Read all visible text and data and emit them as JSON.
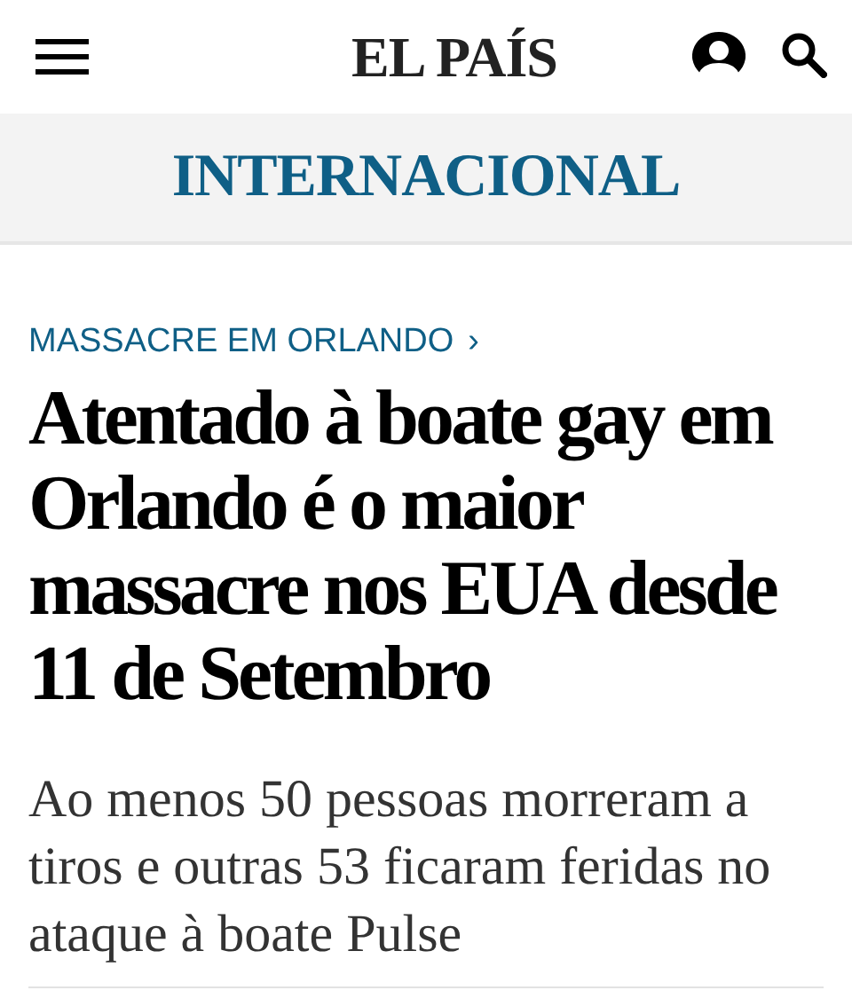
{
  "header": {
    "logo": "EL PAÍS"
  },
  "section": {
    "title": "INTERNACIONAL"
  },
  "article": {
    "kicker": "MASSACRE EM ORLANDO",
    "kicker_arrow": "›",
    "headline": "Atentado à boate gay em Orlando é o maior massacre nos EUA desde 11 de Setembro",
    "deck": "Ao menos 50 pessoas morreram a tiros e outras 53 ficaram feridas no ataque à boate Pulse"
  }
}
